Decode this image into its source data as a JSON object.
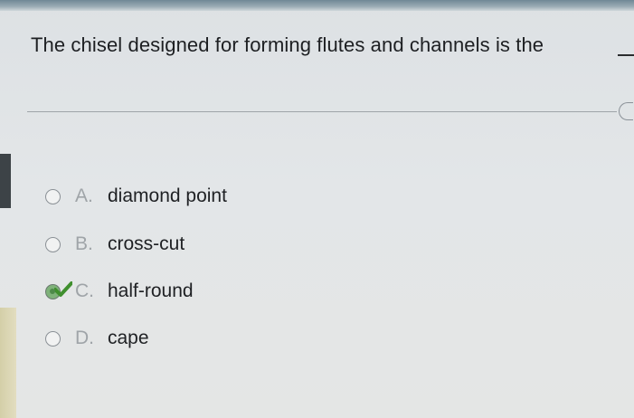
{
  "question": {
    "text": "The chisel designed for forming flutes and channels is the"
  },
  "options": [
    {
      "letter": "A.",
      "text": "diamond point",
      "selected": false
    },
    {
      "letter": "B.",
      "text": "cross-cut",
      "selected": false
    },
    {
      "letter": "C.",
      "text": "half-round",
      "selected": true
    },
    {
      "letter": "D.",
      "text": "cape",
      "selected": false
    }
  ],
  "colors": {
    "correct_check": "#3f8f2e",
    "selected_radio": "#7fb27a"
  },
  "icons": {
    "correct": "check-icon",
    "expand": "expand-icon"
  }
}
